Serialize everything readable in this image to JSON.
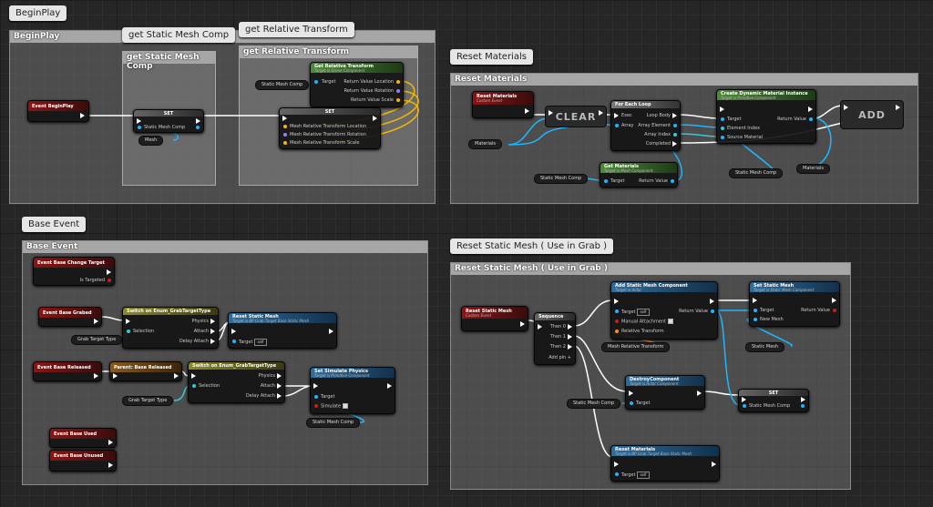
{
  "bubbles": {
    "beginplay": "BeginPlay",
    "get_static_mesh_comp": "get Static Mesh Comp",
    "get_relative_transform": "get Relative Transform",
    "reset_materials": "Reset Materials",
    "base_event": "Base Event",
    "reset_static_mesh": "Reset Static Mesh ( Use in Grab )"
  },
  "comments": {
    "beginplay": "BeginPlay",
    "get_static_mesh_comp": "get Static Mesh Comp",
    "get_relative_transform": "get Relative Transform",
    "reset_materials": "Reset Materials",
    "base_event": "Base Event",
    "reset_static_mesh": "Reset Static Mesh ( Use in Grab )"
  },
  "beginplay_group": {
    "event_beginplay": "Event BeginPlay",
    "set_title": "SET",
    "static_mesh_comp": "Static Mesh Comp",
    "mesh_var": "Mesh",
    "static_mesh_comp_var": "Static Mesh Comp",
    "grt_title": "Get Relative Transform",
    "grt_sub": "Target is Scene Component",
    "target": "Target",
    "rv_location": "Return Value Location",
    "rv_rotation": "Return Value Rotation",
    "rv_scale": "Return Value Scale",
    "set2_title": "SET",
    "mesh_loc": "Mesh Relative Transform Location",
    "mesh_rot": "Mesh Relative Transform Rotation",
    "mesh_scale": "Mesh Relative Transform Scale"
  },
  "reset_materials_group": {
    "event_title": "Reset Materials",
    "event_sub": "Custom Event",
    "clear": "CLEAR",
    "materials_var": "Materials",
    "foreach_title": "For Each Loop",
    "exec": "Exec",
    "array": "Array",
    "loop_body": "Loop Body",
    "array_element": "Array Element",
    "array_index": "Array Index",
    "completed": "Completed",
    "cdmi_title": "Create Dynamic Material Instance",
    "cdmi_sub": "Target is Primitive Component",
    "target": "Target",
    "element_index": "Element Index",
    "source_material": "Source Material",
    "return_value": "Return Value",
    "add": "ADD",
    "get_materials_title": "Get Materials",
    "get_materials_sub": "Target is Mesh Component",
    "static_mesh_comp_var": "Static Mesh Comp",
    "static_mesh_comp_var2": "Static Mesh Comp",
    "materials_var2": "Materials"
  },
  "base_event_group": {
    "change_target": "Event Base Change Target",
    "is_targeted": "Is Targeted",
    "grabed": "Event Base Grabed",
    "switch1_title": "Switch on Enum_GrabTargetType",
    "selection": "Selection",
    "physics": "Physics",
    "attach": "Attach",
    "delay_attach": "Delay Attach",
    "grab_target_type": "Grab Target Type",
    "rsm_title": "Reset Static Mesh",
    "rsm_sub": "Target is BP Grab Target Base Static Mesh",
    "target": "Target",
    "self": "self",
    "released": "Event Base Released",
    "parent_released": "Parent: Base Released",
    "switch2_title": "Switch on Enum_GrabTargetType",
    "grab_target_type2": "Grab Target Type",
    "ssp_title": "Set Simulate Physics",
    "ssp_sub": "Target is Primitive Component",
    "simulate": "Simulate",
    "static_mesh_comp_var": "Static Mesh Comp",
    "used": "Event Base Used",
    "unused": "Event Base Unused"
  },
  "reset_static_mesh_group": {
    "event_title": "Reset Static Mesh",
    "event_sub": "Custom Event",
    "sequence": "Sequence",
    "then0": "Then 0",
    "then1": "Then 1",
    "then2": "Then 2",
    "add_pin": "Add pin",
    "asmc_title": "Add Static Mesh Component",
    "asmc_sub": "Target is Actor",
    "target": "Target",
    "self": "self",
    "manual_attachment": "Manual Attachment",
    "relative_transform": "Relative Transform",
    "return_value": "Return Value",
    "mesh_rel_transform": "Mesh Relative Transform",
    "ssm_title": "Set Static Mesh",
    "ssm_sub": "Target is Static Mesh Component",
    "new_mesh": "New Mesh",
    "static_mesh_var": "Static Mesh",
    "destroy_title": "DestroyComponent",
    "destroy_sub": "Target is Actor Component",
    "static_mesh_comp_var": "Static Mesh Comp",
    "set_title": "SET",
    "static_mesh_comp": "Static Mesh Comp",
    "rm_title": "Reset Materials",
    "rm_sub": "Target is BP Grab Target Base Static Mesh"
  }
}
